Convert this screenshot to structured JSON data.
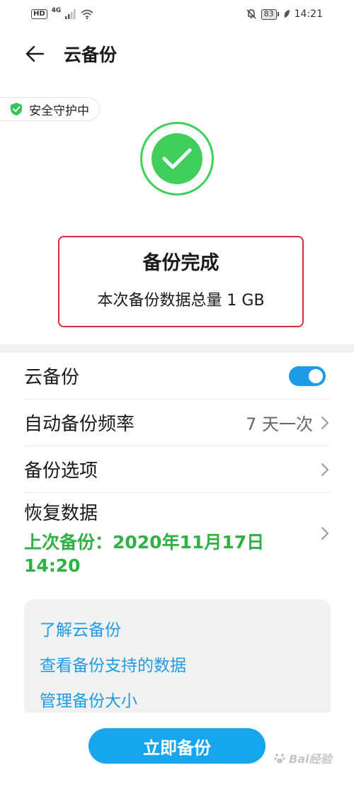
{
  "status_bar": {
    "hd": "HD",
    "network": "4G",
    "battery": "83",
    "time": "14:21"
  },
  "app_bar": {
    "title": "云备份"
  },
  "security": {
    "label": "安全守护中"
  },
  "result": {
    "title": "备份完成",
    "subtitle": "本次备份数据总量 1 GB"
  },
  "settings": {
    "cloud_backup": {
      "label": "云备份",
      "enabled": true
    },
    "auto_frequency": {
      "label": "自动备份频率",
      "value": "7 天一次"
    },
    "backup_options": {
      "label": "备份选项"
    },
    "restore": {
      "label": "恢复数据",
      "last_backup": "上次备份：2020年11月17日 14:20"
    }
  },
  "info_links": {
    "learn": "了解云备份",
    "supported": "查看备份支持的数据",
    "manage": "管理备份大小"
  },
  "action": {
    "backup_now": "立即备份"
  },
  "watermark": {
    "text": "Bai经验"
  },
  "colors": {
    "accent_blue": "#1e9be8",
    "success_green": "#3fcf5a",
    "highlight_red": "#d3303a"
  }
}
